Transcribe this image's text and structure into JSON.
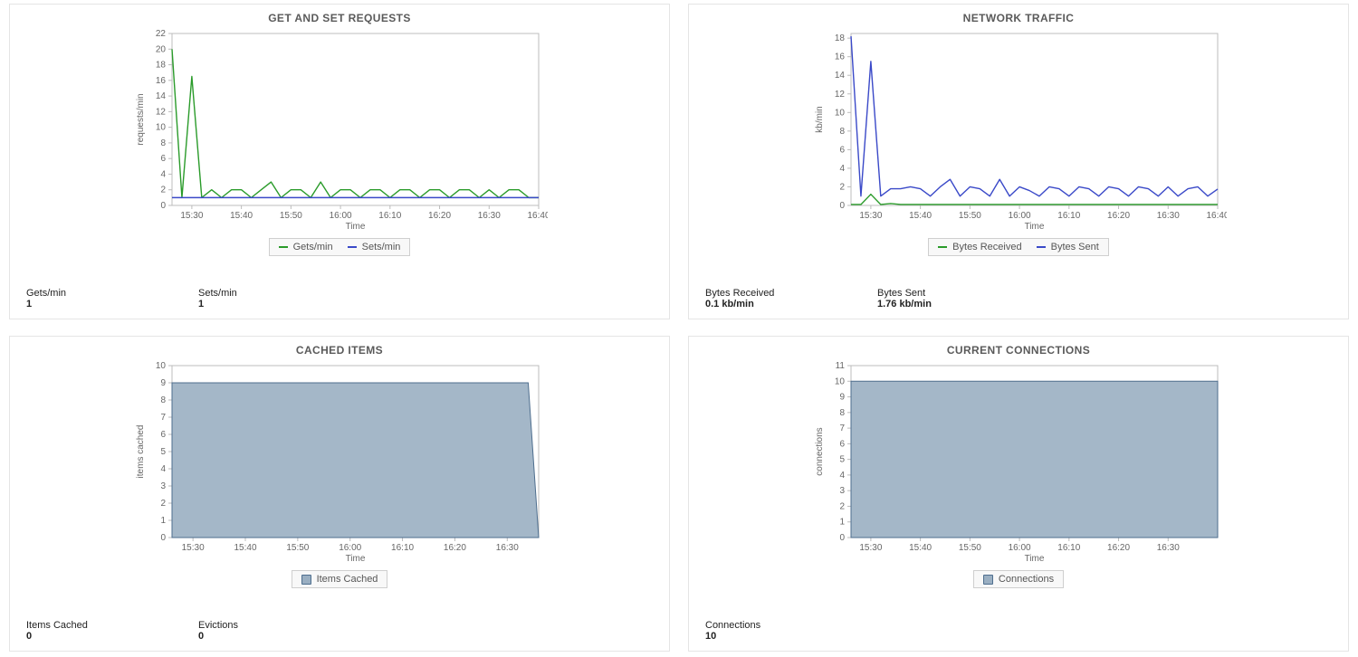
{
  "colors": {
    "green": "#2a9b2a",
    "blue": "#3a49c8",
    "area": "#9aafc2",
    "area_stroke": "#4e6e8e"
  },
  "panels": {
    "requests": {
      "title": "GET AND SET REQUESTS",
      "xlabel": "Time",
      "ylabel": "requests/min",
      "legend": [
        "Gets/min",
        "Sets/min"
      ],
      "stats": [
        {
          "label": "Gets/min",
          "value": "1"
        },
        {
          "label": "Sets/min",
          "value": "1"
        }
      ]
    },
    "network": {
      "title": "NETWORK TRAFFIC",
      "xlabel": "Time",
      "ylabel": "kb/min",
      "legend": [
        "Bytes Received",
        "Bytes Sent"
      ],
      "stats": [
        {
          "label": "Bytes Received",
          "value": "0.1 kb/min"
        },
        {
          "label": "Bytes Sent",
          "value": "1.76 kb/min"
        }
      ]
    },
    "cached": {
      "title": "CACHED ITEMS",
      "xlabel": "Time",
      "ylabel": "items cached",
      "legend": [
        "Items Cached"
      ],
      "stats": [
        {
          "label": "Items Cached",
          "value": "0"
        },
        {
          "label": "Evictions",
          "value": "0"
        }
      ]
    },
    "connections": {
      "title": "CURRENT CONNECTIONS",
      "xlabel": "Time",
      "ylabel": "connections",
      "legend": [
        "Connections"
      ],
      "stats": [
        {
          "label": "Connections",
          "value": "10"
        }
      ]
    }
  },
  "chart_data": [
    {
      "id": "requests",
      "type": "line",
      "xlabel": "Time",
      "ylabel": "requests/min",
      "x_categories": [
        "15:26",
        "15:28",
        "15:30",
        "15:32",
        "15:34",
        "15:36",
        "15:38",
        "15:40",
        "15:42",
        "15:44",
        "15:46",
        "15:48",
        "15:50",
        "15:52",
        "15:54",
        "15:56",
        "15:58",
        "16:00",
        "16:02",
        "16:04",
        "16:06",
        "16:08",
        "16:10",
        "16:12",
        "16:14",
        "16:16",
        "16:18",
        "16:20",
        "16:22",
        "16:24",
        "16:26",
        "16:28",
        "16:30",
        "16:32",
        "16:34",
        "16:36",
        "16:38",
        "16:40"
      ],
      "x_ticks": [
        "15:30",
        "15:40",
        "15:50",
        "16:00",
        "16:10",
        "16:20",
        "16:30",
        "16:40"
      ],
      "y_ticks": [
        0,
        2,
        4,
        6,
        8,
        10,
        12,
        14,
        16,
        18,
        20,
        22
      ],
      "ylim": [
        0,
        22
      ],
      "series": [
        {
          "name": "Gets/min",
          "color": "green",
          "values": [
            20,
            1,
            16.5,
            1,
            2,
            1,
            2,
            2,
            1,
            2,
            3,
            1,
            2,
            2,
            1,
            3,
            1,
            2,
            2,
            1,
            2,
            2,
            1,
            2,
            2,
            1,
            2,
            2,
            1,
            2,
            2,
            1,
            2,
            1,
            2,
            2,
            1,
            1
          ]
        },
        {
          "name": "Sets/min",
          "color": "blue",
          "values": [
            1,
            1,
            1,
            1,
            1,
            1,
            1,
            1,
            1,
            1,
            1,
            1,
            1,
            1,
            1,
            1,
            1,
            1,
            1,
            1,
            1,
            1,
            1,
            1,
            1,
            1,
            1,
            1,
            1,
            1,
            1,
            1,
            1,
            1,
            1,
            1,
            1,
            1
          ]
        }
      ]
    },
    {
      "id": "network",
      "type": "line",
      "xlabel": "Time",
      "ylabel": "kb/min",
      "x_categories": [
        "15:26",
        "15:28",
        "15:30",
        "15:32",
        "15:34",
        "15:36",
        "15:38",
        "15:40",
        "15:42",
        "15:44",
        "15:46",
        "15:48",
        "15:50",
        "15:52",
        "15:54",
        "15:56",
        "15:58",
        "16:00",
        "16:02",
        "16:04",
        "16:06",
        "16:08",
        "16:10",
        "16:12",
        "16:14",
        "16:16",
        "16:18",
        "16:20",
        "16:22",
        "16:24",
        "16:26",
        "16:28",
        "16:30",
        "16:32",
        "16:34",
        "16:36",
        "16:38",
        "16:40"
      ],
      "x_ticks": [
        "15:30",
        "15:40",
        "15:50",
        "16:00",
        "16:10",
        "16:20",
        "16:30",
        "16:40"
      ],
      "y_ticks": [
        0,
        2,
        4,
        6,
        8,
        10,
        12,
        14,
        16,
        18
      ],
      "ylim": [
        0,
        18.5
      ],
      "series": [
        {
          "name": "Bytes Received",
          "color": "green",
          "values": [
            0.1,
            0.1,
            1.2,
            0.1,
            0.2,
            0.1,
            0.1,
            0.1,
            0.1,
            0.1,
            0.1,
            0.1,
            0.1,
            0.1,
            0.1,
            0.1,
            0.1,
            0.1,
            0.1,
            0.1,
            0.1,
            0.1,
            0.1,
            0.1,
            0.1,
            0.1,
            0.1,
            0.1,
            0.1,
            0.1,
            0.1,
            0.1,
            0.1,
            0.1,
            0.1,
            0.1,
            0.1,
            0.1
          ]
        },
        {
          "name": "Bytes Sent",
          "color": "blue",
          "values": [
            18.2,
            1.0,
            15.5,
            1.0,
            1.8,
            1.8,
            2.0,
            1.8,
            1.0,
            2.0,
            2.8,
            1.0,
            2.0,
            1.8,
            1.0,
            2.8,
            1.0,
            2.0,
            1.6,
            1.0,
            2.0,
            1.8,
            1.0,
            2.0,
            1.8,
            1.0,
            2.0,
            1.8,
            1.0,
            2.0,
            1.8,
            1.0,
            2.0,
            1.0,
            1.8,
            2.0,
            1.0,
            1.76
          ]
        }
      ]
    },
    {
      "id": "cached",
      "type": "area",
      "xlabel": "Time",
      "ylabel": "items cached",
      "x_categories": [
        "15:26",
        "15:28",
        "15:30",
        "15:32",
        "15:34",
        "15:36",
        "15:38",
        "15:40",
        "15:42",
        "15:44",
        "15:46",
        "15:48",
        "15:50",
        "15:52",
        "15:54",
        "15:56",
        "15:58",
        "16:00",
        "16:02",
        "16:04",
        "16:06",
        "16:08",
        "16:10",
        "16:12",
        "16:14",
        "16:16",
        "16:18",
        "16:20",
        "16:22",
        "16:24",
        "16:26",
        "16:28",
        "16:30",
        "16:32",
        "16:34",
        "16:36"
      ],
      "x_ticks": [
        "15:30",
        "15:40",
        "15:50",
        "16:00",
        "16:10",
        "16:20",
        "16:30"
      ],
      "y_ticks": [
        0,
        1,
        2,
        3,
        4,
        5,
        6,
        7,
        8,
        9,
        10
      ],
      "ylim": [
        0,
        10
      ],
      "series": [
        {
          "name": "Items Cached",
          "color": "area",
          "values": [
            9,
            9,
            9,
            9,
            9,
            9,
            9,
            9,
            9,
            9,
            9,
            9,
            9,
            9,
            9,
            9,
            9,
            9,
            9,
            9,
            9,
            9,
            9,
            9,
            9,
            9,
            9,
            9,
            9,
            9,
            9,
            9,
            9,
            9,
            9,
            0
          ]
        }
      ]
    },
    {
      "id": "connections",
      "type": "area",
      "xlabel": "Time",
      "ylabel": "connections",
      "x_categories": [
        "15:26",
        "15:28",
        "15:30",
        "15:32",
        "15:34",
        "15:36",
        "15:38",
        "15:40",
        "15:42",
        "15:44",
        "15:46",
        "15:48",
        "15:50",
        "15:52",
        "15:54",
        "15:56",
        "15:58",
        "16:00",
        "16:02",
        "16:04",
        "16:06",
        "16:08",
        "16:10",
        "16:12",
        "16:14",
        "16:16",
        "16:18",
        "16:20",
        "16:22",
        "16:24",
        "16:26",
        "16:28",
        "16:30",
        "16:32",
        "16:34",
        "16:36",
        "16:38",
        "16:40"
      ],
      "x_ticks": [
        "15:30",
        "15:40",
        "15:50",
        "16:00",
        "16:10",
        "16:20",
        "16:30"
      ],
      "y_ticks": [
        0,
        1,
        2,
        3,
        4,
        5,
        6,
        7,
        8,
        9,
        10,
        11
      ],
      "ylim": [
        0,
        11
      ],
      "series": [
        {
          "name": "Connections",
          "color": "area",
          "values": [
            10,
            10,
            10,
            10,
            10,
            10,
            10,
            10,
            10,
            10,
            10,
            10,
            10,
            10,
            10,
            10,
            10,
            10,
            10,
            10,
            10,
            10,
            10,
            10,
            10,
            10,
            10,
            10,
            10,
            10,
            10,
            10,
            10,
            10,
            10,
            10,
            10,
            10
          ]
        }
      ]
    }
  ]
}
